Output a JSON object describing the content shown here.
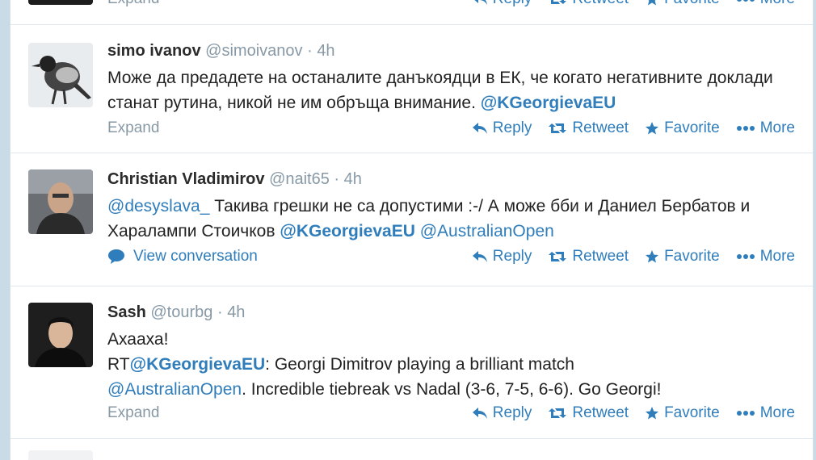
{
  "top_partial": {
    "expand_label": "Expand",
    "actions": [
      "Reply",
      "Retweet",
      "Favorite",
      "More"
    ]
  },
  "tweets": [
    {
      "name": "simo ivanov",
      "handle": "@simoivanov",
      "sep": "·",
      "time": "4h",
      "text_1": "Може да предадете на останалите данъкоядци в ЕК, че когато негативните доклади станат рутина, никой не им обръща внимание.",
      "mention_1": "@KGeorgievaEU",
      "footer_left": "Expand",
      "actions": [
        "Reply",
        "Retweet",
        "Favorite",
        "More"
      ]
    },
    {
      "name": "Christian Vladimirov",
      "handle": "@nait65",
      "sep": "·",
      "time": "4h",
      "mention_0": "@desyslava_",
      "text_1": "Такива грешки не са допустими :-/ А може бби и Даниел Бербатов и Харалампи Стоичков",
      "mention_1": "@KGeorgievaEU",
      "mention_2": "@AustralianOpen",
      "footer_left": "View conversation",
      "actions": [
        "Reply",
        "Retweet",
        "Favorite",
        "More"
      ]
    },
    {
      "name": "Sash",
      "handle": "@tourbg",
      "sep": "·",
      "time": "4h",
      "line_1": "Ахааха!",
      "rt_prefix": "RT",
      "mention_1": "@KGeorgievaEU",
      "text_2": ": Georgi Dimitrov playing a brilliant match",
      "mention_2": "@AustralianOpen",
      "text_3": ". Incredible tiebreak vs Nadal (3-6, 7-5, 6-6). Go Georgi!",
      "footer_left": "Expand",
      "actions": [
        "Reply",
        "Retweet",
        "Favorite",
        "More"
      ]
    }
  ],
  "colors": {
    "link": "#2f7dbb",
    "muted": "#8899a6",
    "background": "#c9dbe6"
  },
  "icons": [
    "reply-icon",
    "retweet-icon",
    "favorite-star-icon",
    "more-dots-icon",
    "speech-bubble-icon"
  ]
}
